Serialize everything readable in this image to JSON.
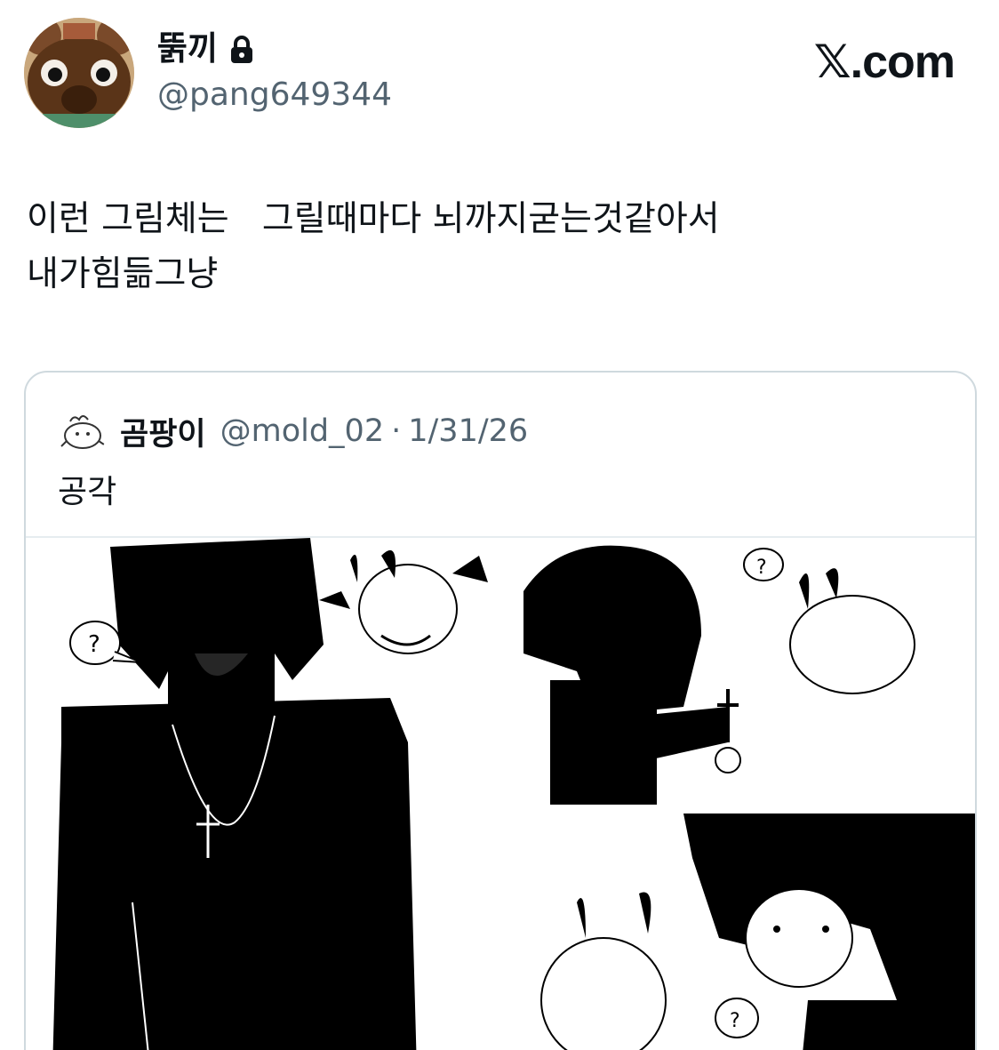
{
  "header": {
    "display_name": "뚥끼",
    "handle": "@pang649344",
    "brand": "𝕏.com",
    "icons": [
      "avatar-raccoon",
      "lock-icon"
    ]
  },
  "tweet": {
    "text": "이런 그림체는   그릴때마다 뇌까지굳는것같아서\n내가힘듦그냥"
  },
  "quote": {
    "name": "곰팡이",
    "handle": "@mold_02",
    "separator": "·",
    "date": "1/31/26",
    "text": "공각"
  },
  "colors": {
    "text": "#0f1419",
    "secondary": "#536471",
    "border": "#cfd9de"
  }
}
